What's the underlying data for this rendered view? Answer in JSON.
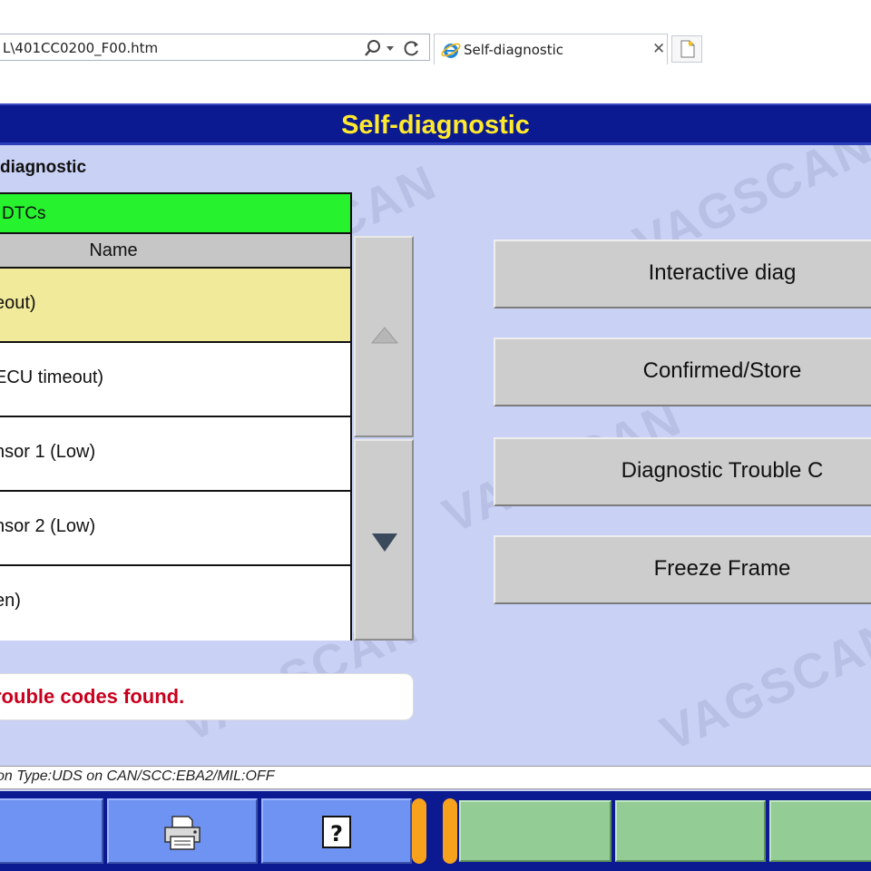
{
  "browser": {
    "address": "L\\401CC0200_F00.htm",
    "tab_title": "Self-diagnostic"
  },
  "app": {
    "title": "Self-diagnostic",
    "section_label": "diagnostic",
    "dtc_header": "DTCs",
    "column_name": "Name",
    "rows": [
      {
        "text": "eout)"
      },
      {
        "text": "ECU timeout)"
      },
      {
        "text": "nsor 1 (Low)"
      },
      {
        "text": "nsor 2 (Low)"
      },
      {
        "text": "en)"
      }
    ],
    "result_message": "rouble codes found.",
    "buttons": {
      "interactive": "Interactive diag",
      "confirmed": "Confirmed/Store",
      "dtc": "Diagnostic Trouble C",
      "freeze": "Freeze Frame"
    },
    "status": "on Type:UDS on CAN/SCC:EBA2/MIL:OFF",
    "watermark": "VAGSCAN"
  },
  "colors": {
    "title_bg": "#0c1a92",
    "title_text": "#ffea2d",
    "dtc_header_bg": "#26f22d",
    "selected_row": "#f1ea9a",
    "error_text": "#c8001e",
    "panel_bg": "#c9d1f4"
  },
  "icons": {
    "search": "search-icon",
    "dropdown": "chevron-down-icon",
    "refresh": "refresh-icon",
    "ie": "ie-icon",
    "close": "close-icon",
    "new_tab": "new-tab-icon",
    "scroll_up": "triangle-up-icon",
    "scroll_down": "triangle-down-icon",
    "printer": "printer-icon",
    "help": "help-icon"
  }
}
